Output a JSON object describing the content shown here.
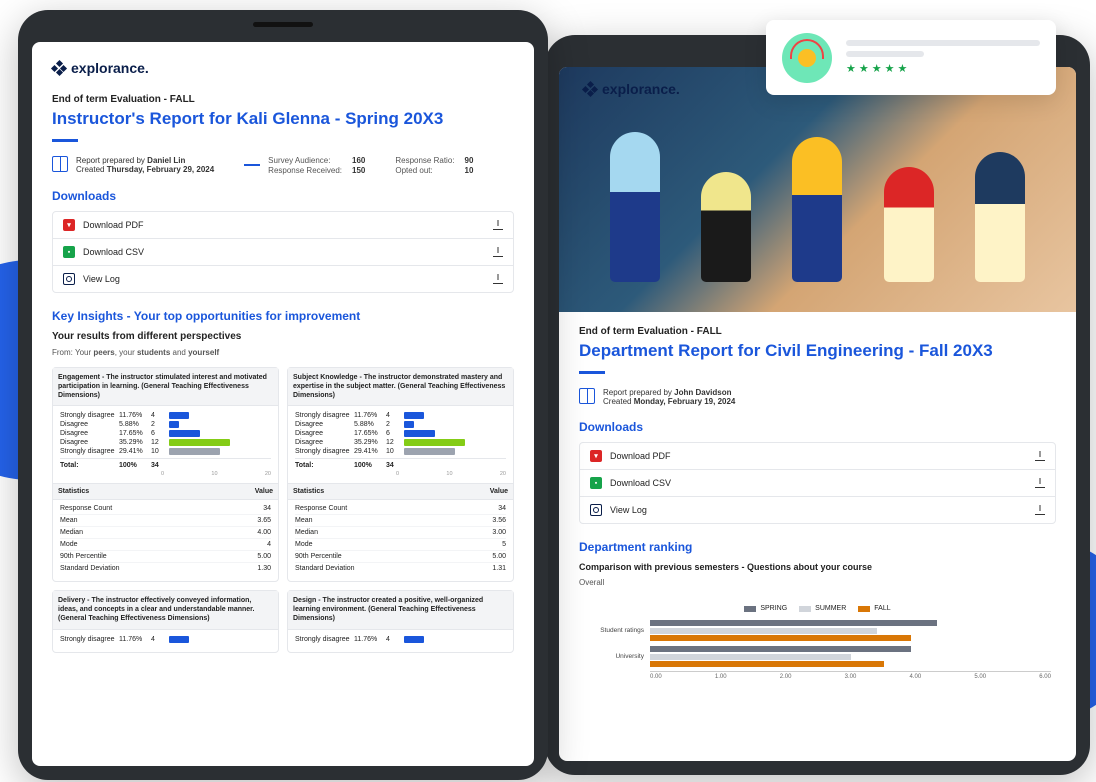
{
  "brand": "explorance.",
  "tablet1": {
    "subtitle": "End of term Evaluation - FALL",
    "title": "Instructor's Report for Kali Glenna - Spring 20X3",
    "prepared_by_label": "Report prepared by",
    "prepared_by": "Daniel Lin",
    "created_label": "Created",
    "created": "Thursday, February 29, 2024",
    "survey": {
      "audience_label": "Survey Audience:",
      "audience": "160",
      "received_label": "Response Received:",
      "received": "150",
      "ratio_label": "Response Ratio:",
      "ratio": "90",
      "opted_label": "Opted out:",
      "opted": "10"
    },
    "downloads_heading": "Downloads",
    "downloads": [
      {
        "label": "Download PDF",
        "icon": "pdf"
      },
      {
        "label": "Download CSV",
        "icon": "csv"
      },
      {
        "label": "View Log",
        "icon": "log"
      }
    ],
    "insights_heading": "Key Insights - Your top opportunities for improvement",
    "perspectives_heading": "Your results from different perspectives",
    "perspectives_caption_prefix": "From: Your ",
    "perspectives_caption_parts": [
      "peers",
      ", your ",
      "students",
      " and ",
      "yourself"
    ],
    "cards": [
      {
        "title": "Engagement - The instructor stimulated interest and motivated participation in learning. (General Teaching Effectiveness Dimensions)",
        "rows": [
          {
            "label": "Strongly disagree",
            "pct": "11.76%",
            "n": "4",
            "w": 20,
            "color": "blue"
          },
          {
            "label": "Disagree",
            "pct": "5.88%",
            "n": "2",
            "w": 10,
            "color": "blue"
          },
          {
            "label": "Disagree",
            "pct": "17.65%",
            "n": "6",
            "w": 30,
            "color": "blue"
          },
          {
            "label": "Disagree",
            "pct": "35.29%",
            "n": "12",
            "w": 60,
            "color": "green"
          },
          {
            "label": "Strongly disagree",
            "pct": "29.41%",
            "n": "10",
            "w": 50,
            "color": "gray"
          }
        ],
        "total_label": "Total:",
        "total_pct": "100%",
        "total_n": "34",
        "ticks": [
          "0",
          "10",
          "20"
        ],
        "stats_head_l": "Statistics",
        "stats_head_r": "Value",
        "stats": [
          {
            "l": "Response Count",
            "v": "34"
          },
          {
            "l": "Mean",
            "v": "3.65"
          },
          {
            "l": "Median",
            "v": "4.00"
          },
          {
            "l": "Mode",
            "v": "4"
          },
          {
            "l": "90th Percentile",
            "v": "5.00"
          },
          {
            "l": "Standard Deviation",
            "v": "1.30"
          }
        ]
      },
      {
        "title": "Subject Knowledge - The instructor demonstrated mastery and expertise in the subject matter. (General Teaching Effectiveness Dimensions)",
        "rows": [
          {
            "label": "Strongly disagree",
            "pct": "11.76%",
            "n": "4",
            "w": 20,
            "color": "blue"
          },
          {
            "label": "Disagree",
            "pct": "5.88%",
            "n": "2",
            "w": 10,
            "color": "blue"
          },
          {
            "label": "Disagree",
            "pct": "17.65%",
            "n": "6",
            "w": 30,
            "color": "blue"
          },
          {
            "label": "Disagree",
            "pct": "35.29%",
            "n": "12",
            "w": 60,
            "color": "green"
          },
          {
            "label": "Strongly disagree",
            "pct": "29.41%",
            "n": "10",
            "w": 50,
            "color": "gray"
          }
        ],
        "total_label": "Total:",
        "total_pct": "100%",
        "total_n": "34",
        "ticks": [
          "0",
          "10",
          "20"
        ],
        "stats_head_l": "Statistics",
        "stats_head_r": "Value",
        "stats": [
          {
            "l": "Response Count",
            "v": "34"
          },
          {
            "l": "Mean",
            "v": "3.56"
          },
          {
            "l": "Median",
            "v": "3.00"
          },
          {
            "l": "Mode",
            "v": "5"
          },
          {
            "l": "90th Percentile",
            "v": "5.00"
          },
          {
            "l": "Standard Deviation",
            "v": "1.31"
          }
        ]
      },
      {
        "title": "Delivery - The instructor effectively conveyed information, ideas, and concepts in a clear and understandable manner. (General Teaching Effectiveness Dimensions)",
        "rows": [
          {
            "label": "Strongly disagree",
            "pct": "11.76%",
            "n": "4",
            "w": 20,
            "color": "blue"
          }
        ]
      },
      {
        "title": "Design - The instructor created a positive, well-organized learning environment. (General Teaching Effectiveness Dimensions)",
        "rows": [
          {
            "label": "Strongly disagree",
            "pct": "11.76%",
            "n": "4",
            "w": 20,
            "color": "blue"
          }
        ]
      }
    ]
  },
  "tablet2": {
    "subtitle": "End of term Evaluation - FALL",
    "title": "Department Report for Civil Engineering - Fall 20X3",
    "prepared_by_label": "Report prepared by",
    "prepared_by": "John Davidson",
    "created_label": "Created",
    "created": "Monday, February 19, 2024",
    "downloads_heading": "Downloads",
    "downloads": [
      {
        "label": "Download PDF",
        "icon": "pdf"
      },
      {
        "label": "Download CSV",
        "icon": "csv"
      },
      {
        "label": "View Log",
        "icon": "log"
      }
    ],
    "ranking_heading": "Department ranking",
    "ranking_sub": "Comparison with previous semesters - Questions about your course",
    "overall_label": "Overall"
  },
  "chart_data": {
    "type": "bar",
    "orientation": "horizontal",
    "categories": [
      "Student ratings",
      "University"
    ],
    "series": [
      {
        "name": "SPRING",
        "color": "#6b7280",
        "values": [
          4.3,
          3.9
        ]
      },
      {
        "name": "SUMMER",
        "color": "#d1d5db",
        "values": [
          3.4,
          3.0
        ]
      },
      {
        "name": "FALL",
        "color": "#d97706",
        "values": [
          3.9,
          3.5
        ]
      }
    ],
    "xlim": [
      0,
      6
    ],
    "xticks": [
      0.0,
      1.0,
      2.0,
      3.0,
      4.0,
      5.0,
      6.0
    ],
    "title": "",
    "xlabel": "",
    "ylabel": ""
  },
  "review": {
    "stars": 5
  }
}
